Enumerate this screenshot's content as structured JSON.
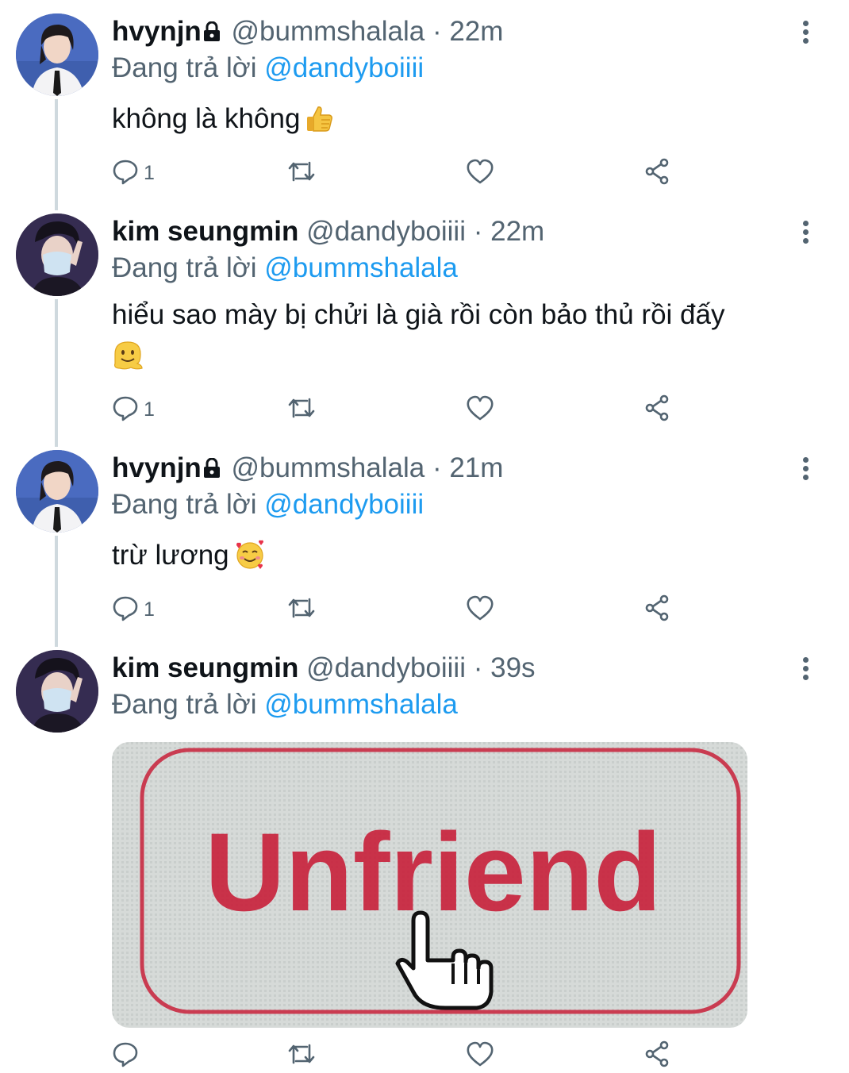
{
  "tweets": [
    {
      "name": "hvynjn",
      "locked": true,
      "handle": "@bummshalala",
      "sep": "·",
      "time": "22m",
      "replying_prefix": "Đang trả lời ",
      "replying_to": "@dandyboiiii",
      "text": "không là không",
      "emoji": "👍",
      "reply_count": "1"
    },
    {
      "name": "kim seungmin",
      "locked": false,
      "handle": "@dandyboiiii",
      "sep": "·",
      "time": "22m",
      "replying_prefix": "Đang trả lời ",
      "replying_to": "@bummshalala",
      "text": "hiểu sao mày bị chửi là già rồi còn bảo thủ rồi đấy",
      "emoji": "🫠",
      "reply_count": "1"
    },
    {
      "name": "hvynjn",
      "locked": true,
      "handle": "@bummshalala",
      "sep": "·",
      "time": "21m",
      "replying_prefix": "Đang trả lời ",
      "replying_to": "@dandyboiiii",
      "text": "trừ lương",
      "emoji": "🥰",
      "reply_count": "1"
    },
    {
      "name": "kim seungmin",
      "locked": false,
      "handle": "@dandyboiiii",
      "sep": "·",
      "time": "39s",
      "replying_prefix": "Đang trả lời ",
      "replying_to": "@bummshalala",
      "media_text": "Unfriend",
      "reply_count": ""
    }
  ],
  "colors": {
    "accent": "#1d9bf0",
    "secondary_text": "#536471",
    "media_red": "#c8203a"
  }
}
